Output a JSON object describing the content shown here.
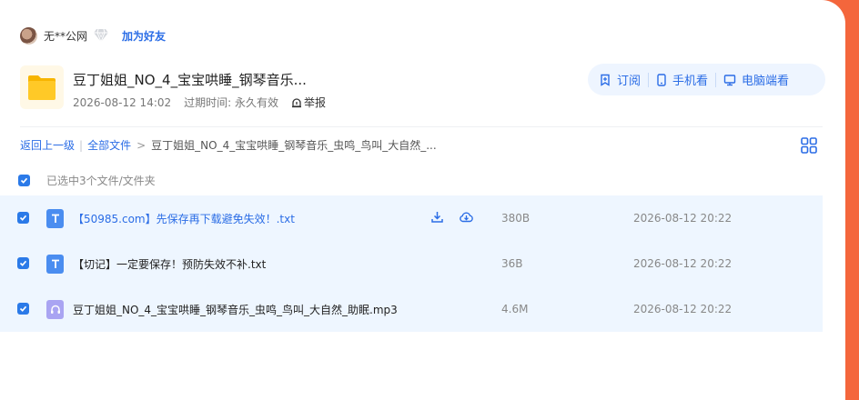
{
  "user": {
    "name": "无**公网",
    "add_friend": "加为好友"
  },
  "share": {
    "title": "豆丁姐姐_NO_4_宝宝哄睡_钢琴音乐...",
    "date": "2026-08-12 14:02",
    "expire_label": "过期时间:",
    "expire_value": "永久有效",
    "report": "举报"
  },
  "actions": {
    "subscribe": "订阅",
    "mobile": "手机看",
    "pc": "电脑端看"
  },
  "breadcrumb": {
    "back": "返回上一级",
    "all": "全部文件",
    "current": "豆丁姐姐_NO_4_宝宝哄睡_钢琴音乐_虫鸣_鸟叫_大自然_..."
  },
  "selection": {
    "text": "已选中3个文件/文件夹"
  },
  "files": [
    {
      "name": "【50985.com】先保存再下载避免失效！.txt",
      "size": "380B",
      "date": "2026-08-12 20:22",
      "type": "txt"
    },
    {
      "name": "【切记】一定要保存！预防失效不补.txt",
      "size": "36B",
      "date": "2026-08-12 20:22",
      "type": "txt"
    },
    {
      "name": "豆丁姐姐_NO_4_宝宝哄睡_钢琴音乐_虫鸣_鸟叫_大自然_助眠.mp3",
      "size": "4.6M",
      "date": "2026-08-12 20:22",
      "type": "mp3"
    }
  ],
  "colors": {
    "accent": "#2b6de6",
    "background": "#f4663c",
    "row_selected": "#eef6ff"
  }
}
